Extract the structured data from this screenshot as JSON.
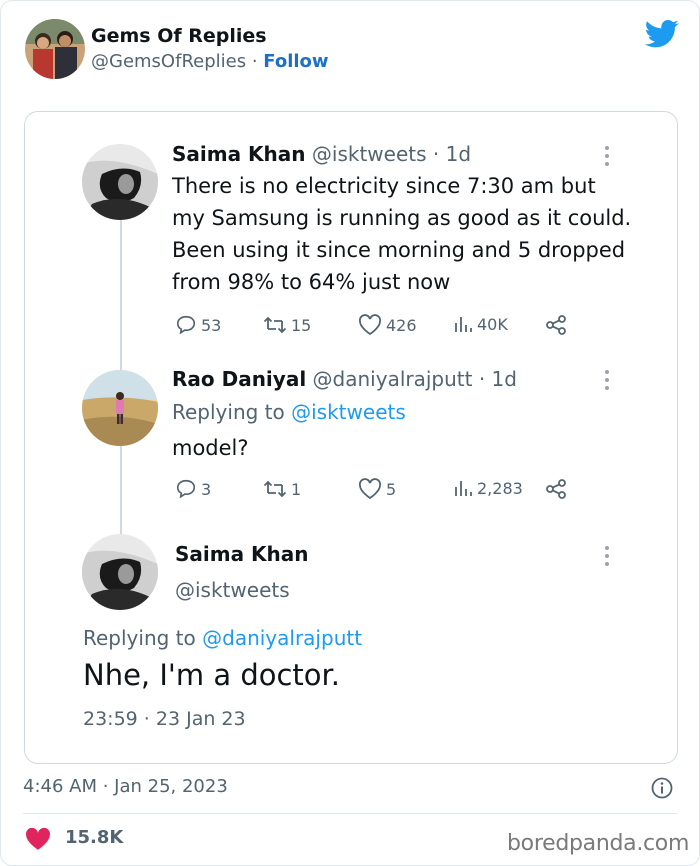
{
  "post": {
    "author_name": "Gems Of Replies",
    "author_handle": "@GemsOfReplies",
    "separator": " · ",
    "follow_label": "Follow",
    "timestamp": "4:46 AM · Jan 25, 2023",
    "likes": "15.8K",
    "brand_color": "#1d9bf0",
    "like_color": "#e0245e"
  },
  "thread": {
    "tweet1": {
      "name": "Saima Khan",
      "meta": " @isktweets · 1d",
      "text": "There is no electricity since 7:30 am but my Samsung is running as good as it could. Been using it since morning and 5 dropped from 98% to 64% just now",
      "replies": "53",
      "retweets": "15",
      "likes": "426",
      "views": "40K"
    },
    "tweet2": {
      "name": "Rao Daniyal",
      "meta": " @daniyalrajputt · 1d",
      "replying_prefix": "Replying to ",
      "replying_handle": "@isktweets",
      "text": "model?",
      "replies": "3",
      "retweets": "1",
      "likes": "5",
      "views": "2,283"
    },
    "tweet3": {
      "name": "Saima Khan",
      "handle": "@isktweets",
      "replying_prefix": "Replying to ",
      "replying_handle": "@daniyalrajputt",
      "text": "Nhe, I'm a doctor.",
      "time": "23:59 · 23 Jan 23"
    }
  },
  "watermark": "boredpanda.com"
}
